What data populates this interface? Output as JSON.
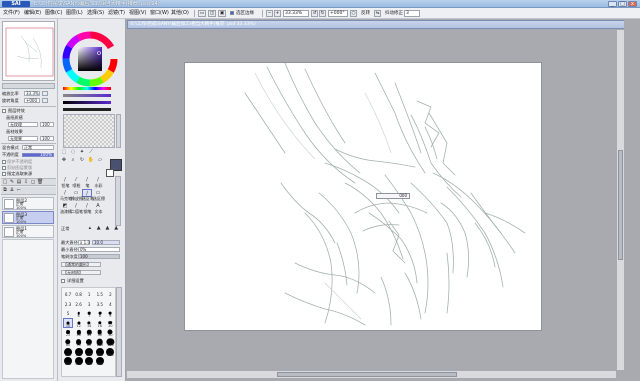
{
  "title_bar": {
    "logo": "SAI",
    "title": "E:\\工作\\完成\\SANY\\编后加工\\相当大精手(推荐 .psd 94)",
    "minimize": "_",
    "maximize": "□",
    "close": "x"
  },
  "menu": {
    "items": [
      "文件(F)",
      "编辑(E)",
      "图像(C)",
      "图层(L)",
      "选择(S)",
      "滤镜(T)",
      "视图(V)",
      "窗口(W)",
      "其他(O)"
    ],
    "select_mode": "选区边缘",
    "zoom": "33.33%",
    "angle": "+000°",
    "flip_label": "反转",
    "stabilizer_label": "抖动修正",
    "stabilizer_value": "3",
    "anti_alias_label": "选区边缘"
  },
  "document": {
    "tab_title": "E:\\工作\\完成\\SANY\\编后加工\\相当大精手(推荐 .psd 33.33%)"
  },
  "left_panel": {
    "zoom_label": "缩放比率",
    "zoom_value": "33.3%",
    "rotate_label": "旋转角度",
    "rotate_value": "+000",
    "effects_title": "图层特效",
    "texture_label": "画纸质感",
    "texture_value": "无纹理",
    "texture_strength": "100",
    "effect_label": "画材效果",
    "effect_value": "无效果",
    "effect_strength": "100",
    "blend_label": "混合模式",
    "blend_value": "正常",
    "opacity_label": "不透明度",
    "opacity_value": "100%",
    "protect_label": "保护不透明度",
    "clip_label": "剪贴图层蒙版",
    "ref_label": "指定选取来源",
    "layers": [
      {
        "name": "图层2",
        "mode": "正常",
        "opacity": "100%"
      },
      {
        "name": "图层3",
        "mode": "正常",
        "opacity": "100%"
      },
      {
        "name": "图层1",
        "mode": "正常",
        "opacity": "100%"
      }
    ]
  },
  "tool_panel": {
    "tools": [
      "铅笔",
      "喷枪",
      "笔",
      "水彩",
      "马克笔",
      "橡皮擦",
      "选区笔",
      "选区擦",
      "油漆桶",
      "二值笔",
      "钢笔",
      "文本"
    ],
    "normal_label": "正常",
    "size_label": "最大直径",
    "size_mult": "x 1.0",
    "size_value": "10.0",
    "min_size_label": "最小直径",
    "min_size_value": "0%",
    "density_label": "笔刷浓度",
    "density_value": "100",
    "shape_label": "【通常的圆形】",
    "texture_label": "【无材质】",
    "detail_label": "详细设置",
    "brush_sizes": [
      "0.7",
      "0.8",
      "1",
      "1.5",
      "2",
      "2.3",
      "2.6",
      "3",
      "3.5",
      "4",
      "5",
      "6",
      "7",
      "8",
      "9",
      "10",
      "12",
      "14",
      "16",
      "20",
      "25",
      "30",
      "35",
      "40",
      "50",
      "60",
      "70",
      "80",
      "100",
      "120",
      "150",
      "170",
      "200",
      "250",
      "300",
      "350",
      "400",
      "450",
      "500"
    ],
    "selected_brush": "10"
  },
  "canvas": {
    "floating_value": "000"
  },
  "colors": {
    "titlebar": "#9cbbe2",
    "panel": "#e8eaed",
    "canvas_bg": "#a8aab0",
    "sketch": "#9aaaa2",
    "selection": "#c6cff0"
  }
}
